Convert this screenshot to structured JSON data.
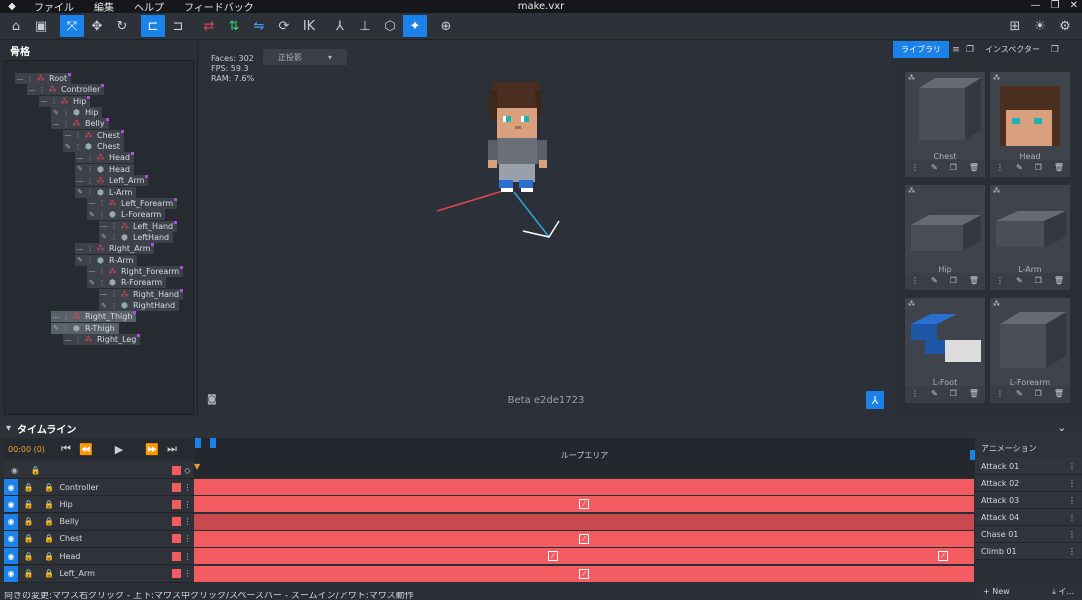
{
  "menubar": {
    "items": [
      "ファイル",
      "編集",
      "ヘルプ",
      "フィードバック"
    ],
    "title": "make.vxr"
  },
  "skeleton": {
    "title": "骨格",
    "nodes": [
      {
        "type": "bone",
        "label": "Root"
      },
      {
        "type": "bone",
        "label": "Controller"
      },
      {
        "type": "bone",
        "label": "Hip"
      },
      {
        "type": "cube",
        "label": "Hip"
      },
      {
        "type": "bone",
        "label": "Belly"
      },
      {
        "type": "bone",
        "label": "Chest"
      },
      {
        "type": "cube",
        "label": "Chest"
      },
      {
        "type": "bone",
        "label": "Head"
      },
      {
        "type": "cube",
        "label": "Head"
      },
      {
        "type": "bone",
        "label": "Left_Arm"
      },
      {
        "type": "cube",
        "label": "L-Arm"
      },
      {
        "type": "bone",
        "label": "Left_Forearm"
      },
      {
        "type": "cube",
        "label": "L-Forearm"
      },
      {
        "type": "bone",
        "label": "Left_Hand"
      },
      {
        "type": "cube",
        "label": "LeftHand"
      },
      {
        "type": "bone",
        "label": "Right_Arm"
      },
      {
        "type": "cube",
        "label": "R-Arm"
      },
      {
        "type": "bone",
        "label": "Right_Forearm"
      },
      {
        "type": "cube",
        "label": "R-Forearm"
      },
      {
        "type": "bone",
        "label": "Right_Hand"
      },
      {
        "type": "cube",
        "label": "RightHand"
      },
      {
        "type": "bone",
        "label": "Right_Thigh"
      },
      {
        "type": "cube",
        "label": "R-Thigh"
      },
      {
        "type": "bone",
        "label": "Right_Leg"
      }
    ]
  },
  "viewport": {
    "faces": "Faces: 302",
    "fps": "FPS: 59.3",
    "ram": "RAM: 7.6%",
    "projection": "正投影",
    "build": "Beta e2de1723"
  },
  "library": {
    "tab_library": "ライブラリ",
    "tab_inspector": "インスペクター",
    "items": [
      "Chest",
      "Head",
      "Hip",
      "L-Arm",
      "L-Foot",
      "L-Forearm"
    ]
  },
  "timeline": {
    "title": "タイムライン",
    "time": "00:00 (0)",
    "loop_area": "ループエリア",
    "rows": [
      {
        "name": "Controller",
        "keys": []
      },
      {
        "name": "Hip",
        "keys": [
          50
        ]
      },
      {
        "name": "Belly",
        "keys": []
      },
      {
        "name": "Chest",
        "keys": [
          50
        ]
      },
      {
        "name": "Head",
        "keys": [
          46,
          96
        ]
      },
      {
        "name": "Left_Arm",
        "keys": [
          50
        ]
      }
    ]
  },
  "animation": {
    "title": "アニメーション",
    "items": [
      "Attack 01",
      "Attack 02",
      "Attack 03",
      "Attack 04",
      "Chase 01",
      "Climb 01"
    ],
    "new_label": "+ New",
    "import_label": "⤓ イ..."
  },
  "status": "向きの変更:マウス右クリック - 上下:マウス中クリック/スペースバー - ズームイン/アウト:マウス動作",
  "colors": {
    "accent": "#1a82e8",
    "track": "#f25b5f",
    "bone": "#e0464f"
  }
}
